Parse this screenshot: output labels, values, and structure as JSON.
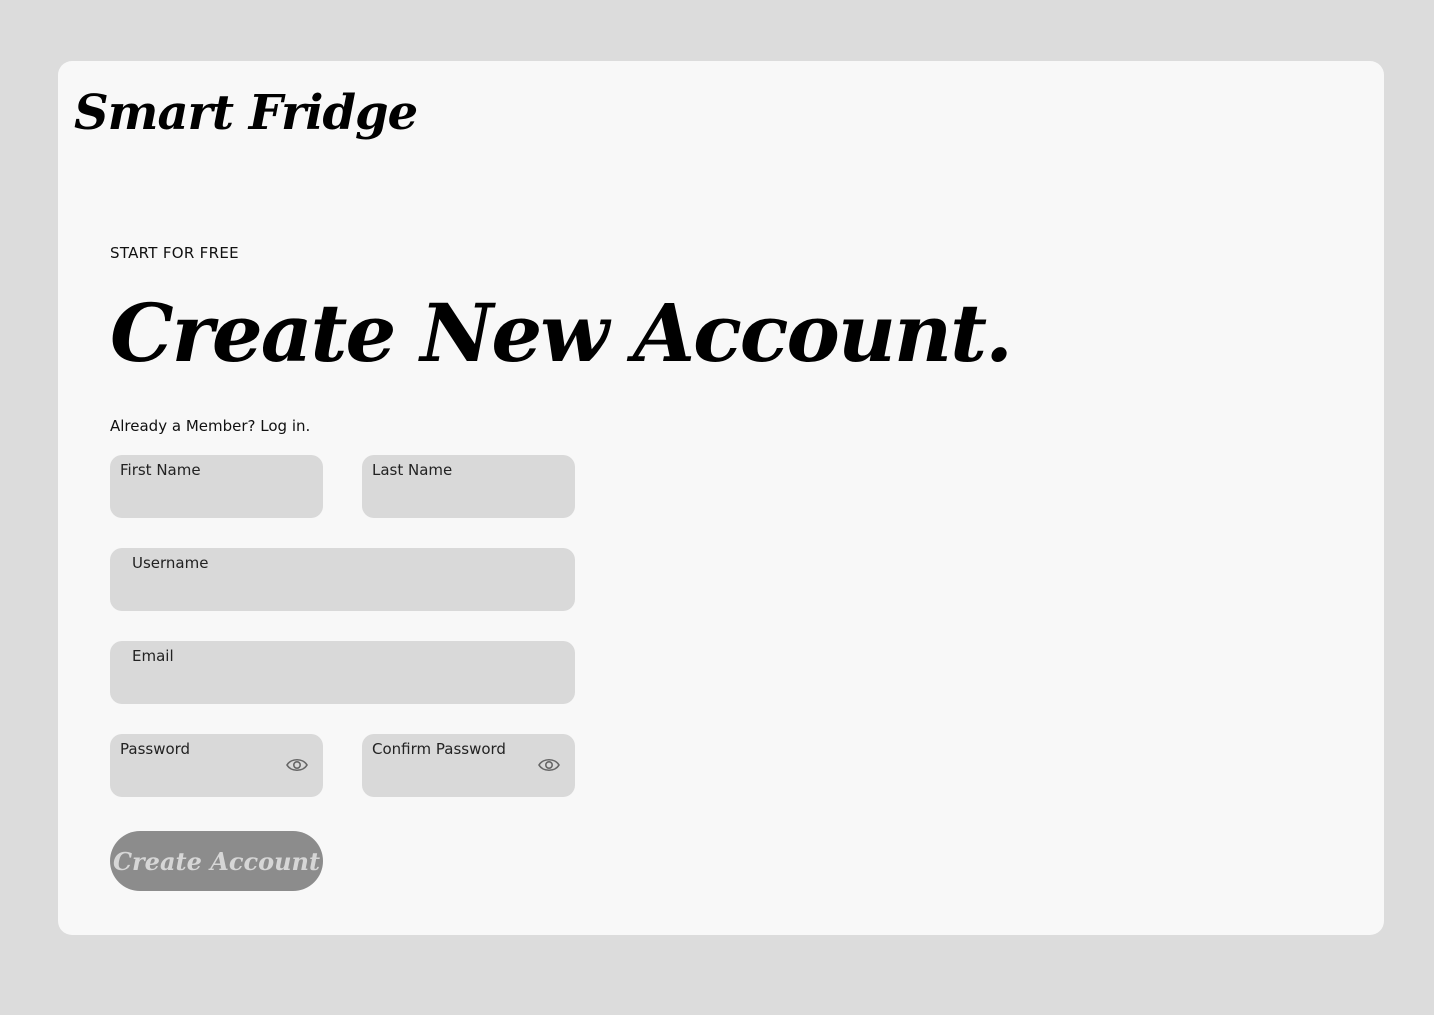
{
  "app": {
    "brand": "Smart Fridge"
  },
  "hero": {
    "eyebrow": "START FOR FREE",
    "title": "Create New Account.",
    "login_prompt": "Already a Member?",
    "login_link": "Log in."
  },
  "form": {
    "fields": [
      {
        "label": "First Name",
        "value": ""
      },
      {
        "label": "Last Name",
        "value": ""
      },
      {
        "label": "Username",
        "value": ""
      },
      {
        "label": "Email",
        "value": ""
      },
      {
        "label": "Password",
        "value": "",
        "icon": "eye-icon"
      },
      {
        "label": "Confirm Password",
        "value": "",
        "icon": "eye-icon"
      }
    ],
    "submit_label": "Create Account"
  },
  "colors": {
    "page_background": "#dcdcdc",
    "card_background": "#f8f8f8",
    "field_background": "#d9d9d9",
    "button_background": "#8c8c8c",
    "button_text": "#d6d6d6"
  }
}
